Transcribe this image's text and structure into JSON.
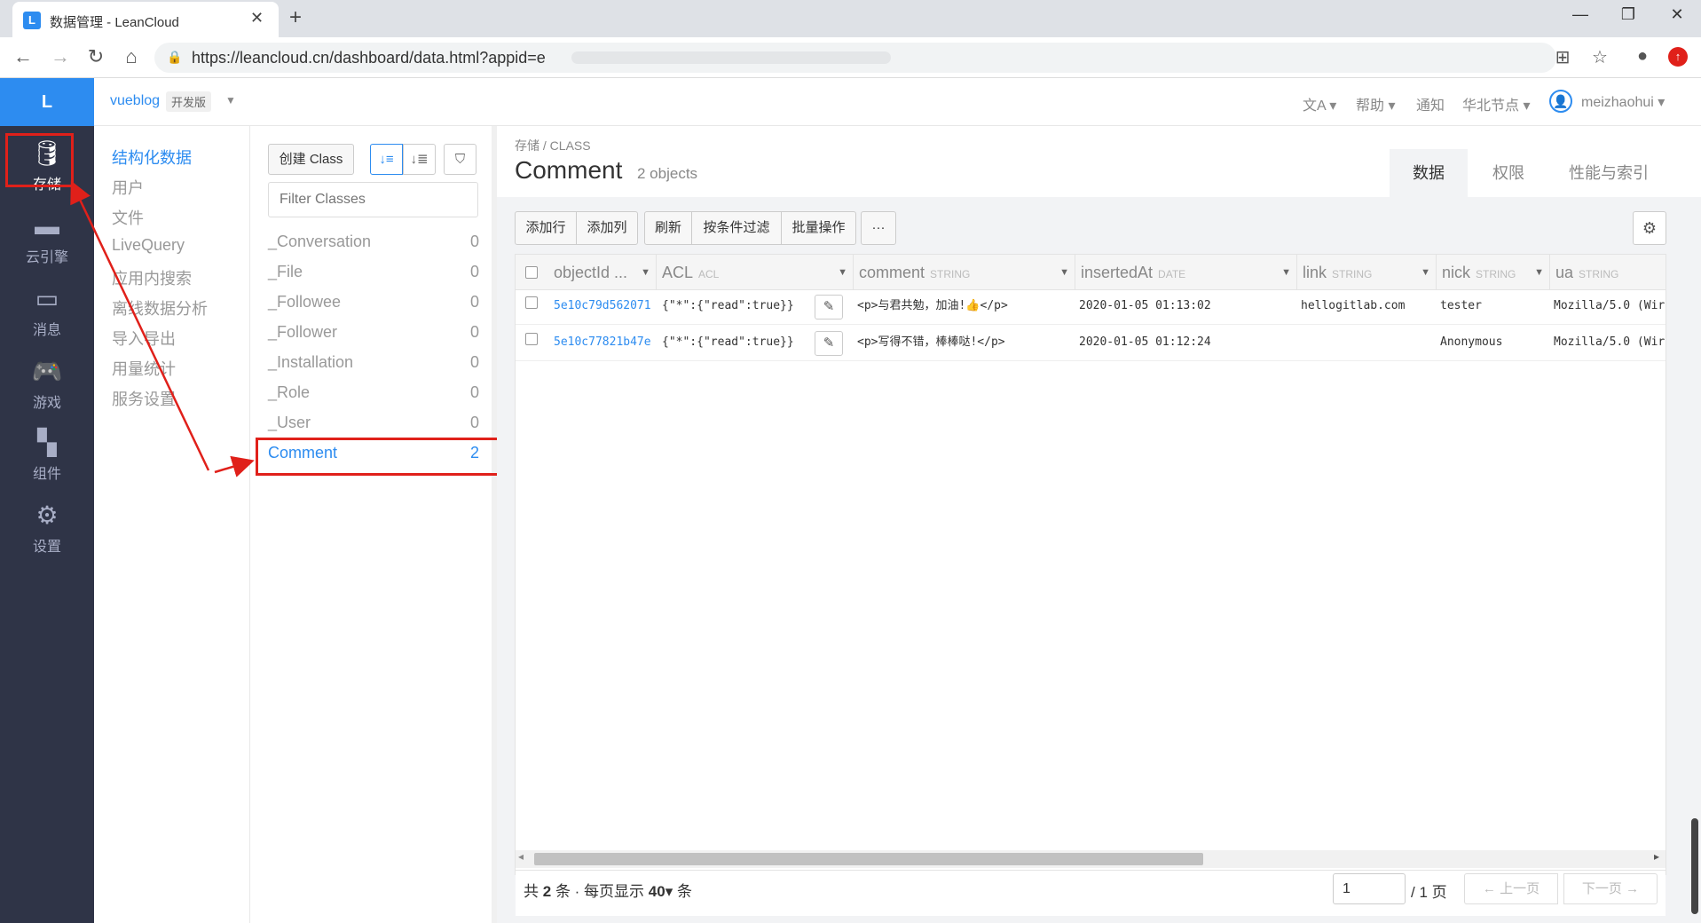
{
  "browser": {
    "tab_title": "数据管理 - LeanCloud",
    "favicon": "L",
    "url": "https://leancloud.cn/dashboard/data.html?appid=e"
  },
  "left_nav": {
    "logo": "L",
    "items": [
      {
        "icon": "database-icon",
        "label": "存储",
        "active": true
      },
      {
        "icon": "cloud-engine-icon",
        "label": "云引擎"
      },
      {
        "icon": "message-icon",
        "label": "消息"
      },
      {
        "icon": "gamepad-icon",
        "label": "游戏"
      },
      {
        "icon": "component-icon",
        "label": "组件"
      },
      {
        "icon": "gear-icon",
        "label": "设置"
      }
    ]
  },
  "header": {
    "app_name": "vueblog",
    "app_badge": "开发版",
    "links": [
      "帮助",
      "通知",
      "华北节点"
    ],
    "user": "meizhaohui"
  },
  "submenu": {
    "items": [
      "结构化数据",
      "用户",
      "文件",
      "LiveQuery",
      "应用内搜索",
      "离线数据分析",
      "导入导出",
      "用量统计",
      "服务设置"
    ]
  },
  "classes": {
    "create_label": "创建 Class",
    "filter_placeholder": "Filter Classes",
    "list": [
      {
        "name": "_Conversation",
        "count": "0"
      },
      {
        "name": "_File",
        "count": "0"
      },
      {
        "name": "_Followee",
        "count": "0"
      },
      {
        "name": "_Follower",
        "count": "0"
      },
      {
        "name": "_Installation",
        "count": "0"
      },
      {
        "name": "_Role",
        "count": "0"
      },
      {
        "name": "_User",
        "count": "0"
      },
      {
        "name": "Comment",
        "count": "2"
      }
    ]
  },
  "main": {
    "breadcrumb": "存储 / CLASS",
    "title": "Comment",
    "object_count": "2 objects",
    "tabs": [
      "数据",
      "权限",
      "性能与索引"
    ],
    "toolbar": [
      "添加行",
      "添加列",
      "刷新",
      "按条件过滤",
      "批量操作",
      "···"
    ],
    "columns": [
      {
        "name": "objectId ...",
        "type": ""
      },
      {
        "name": "ACL",
        "type": "ACL"
      },
      {
        "name": "comment",
        "type": "STRING"
      },
      {
        "name": "insertedAt",
        "type": "DATE"
      },
      {
        "name": "link",
        "type": "STRING"
      },
      {
        "name": "nick",
        "type": "STRING"
      },
      {
        "name": "ua",
        "type": "STRING"
      }
    ],
    "rows": [
      [
        "5e10c79d562071",
        "{\"*\":{\"read\":true}}",
        "<p>与君共勉，加油!👍</p>",
        "2020-01-05 01:13:02",
        "hellogitlab.com",
        "tester",
        "Mozilla/5.0 (Wir"
      ],
      [
        "5e10c77821b47e",
        "{\"*\":{\"read\":true}}",
        "<p>写得不错，棒棒哒!</p>",
        "2020-01-05 01:12:24",
        "",
        "Anonymous",
        "Mozilla/5.0 (Wir"
      ]
    ],
    "footer": {
      "prefix": "共",
      "total": "2",
      "mid": "条 · 每页显示",
      "per_page": "40",
      "suffix": "条",
      "page_value": "1",
      "page_total": "/ 1 页",
      "prev": "上一页",
      "next": "下一页"
    }
  },
  "colors": {
    "accent": "#2d8cf0",
    "nav_bg": "#2f3447",
    "annotation": "#e0201a"
  }
}
